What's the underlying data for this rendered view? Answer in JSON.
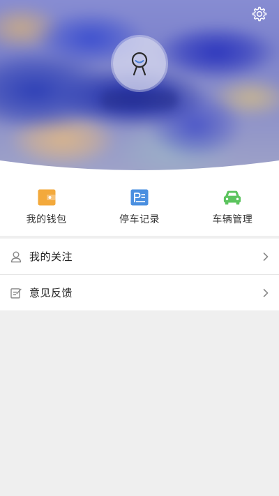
{
  "header": {
    "settings_icon": "gear-icon",
    "avatar_icon": "user-avatar-icon"
  },
  "quick_actions": [
    {
      "label": "我的钱包",
      "icon": "wallet-icon",
      "color": "#f3a93c"
    },
    {
      "label": "停车记录",
      "icon": "parking-record-icon",
      "color": "#4a8fe0"
    },
    {
      "label": "车辆管理",
      "icon": "car-icon",
      "color": "#5cc45e"
    }
  ],
  "menu": [
    {
      "label": "我的关注",
      "icon": "person-icon"
    },
    {
      "label": "意见反馈",
      "icon": "feedback-edit-icon"
    }
  ],
  "colors": {
    "page_background": "#efefef",
    "card_background": "#ffffff",
    "text_primary": "#222222",
    "icon_gray": "#888888"
  }
}
